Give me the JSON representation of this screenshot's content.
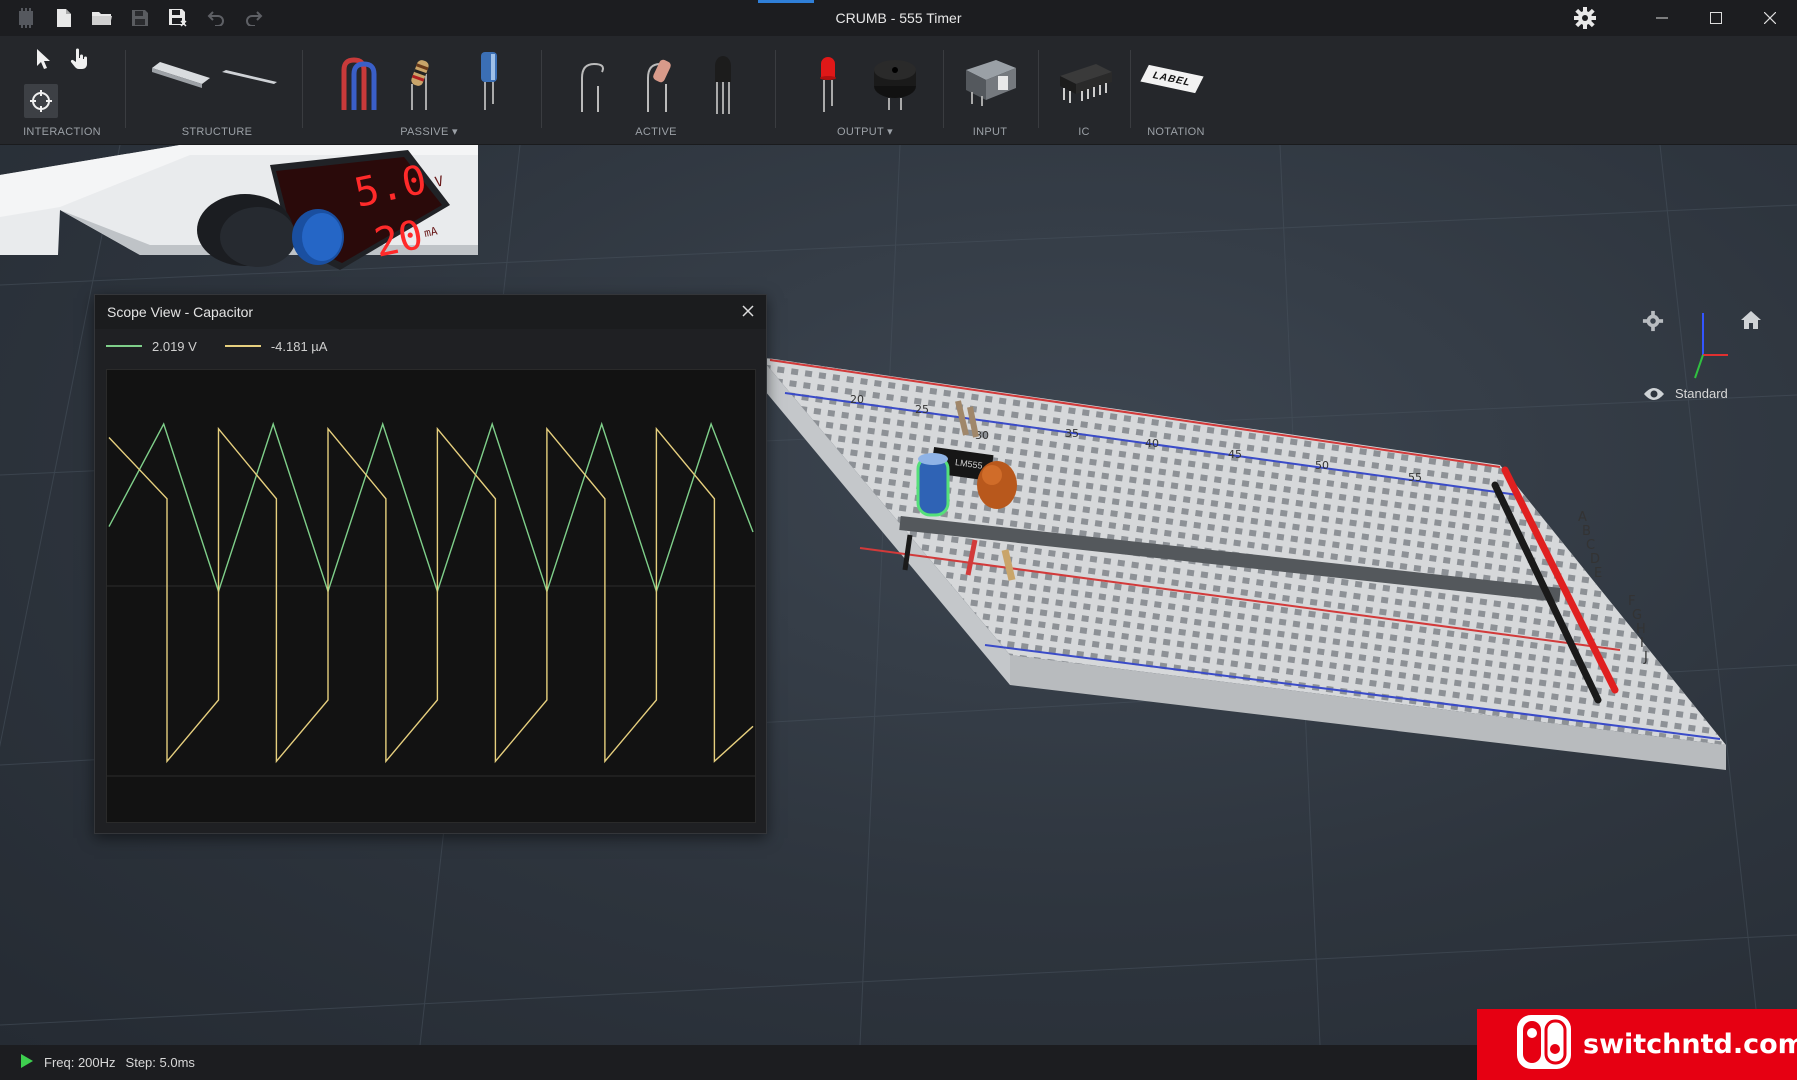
{
  "window": {
    "title": "CRUMB - 555 Timer"
  },
  "toolbar": {
    "groups": [
      {
        "label": "INTERACTION"
      },
      {
        "label": "STRUCTURE"
      },
      {
        "label": "PASSIVE",
        "has_dropdown": true
      },
      {
        "label": "ACTIVE"
      },
      {
        "label": "OUTPUT",
        "has_dropdown": true
      },
      {
        "label": "INPUT"
      },
      {
        "label": "IC"
      },
      {
        "label": "NOTATION"
      }
    ],
    "notation_label_text": "LABEL"
  },
  "power_supply": {
    "voltage": "5.0",
    "voltage_unit": "V",
    "current": "20",
    "current_unit": "mA"
  },
  "scope": {
    "title": "Scope View - Capacitor",
    "legend": [
      {
        "value": "2.019 V",
        "color": "#7fcf8a"
      },
      {
        "value": "-4.181 µA",
        "color": "#e6cf7e"
      }
    ]
  },
  "chart_data": {
    "type": "line",
    "title": "",
    "xlabel": "",
    "ylabel": "",
    "grid": true,
    "series": [
      {
        "name": "2.019 V",
        "color": "#7fcf8a",
        "x": [
          0,
          0.085,
          0.17,
          0.255,
          0.34,
          0.425,
          0.51,
          0.595,
          0.68,
          0.765,
          0.85,
          0.935,
          1.0
        ],
        "y": [
          0.38,
          0.95,
          0.02,
          0.95,
          0.02,
          0.95,
          0.02,
          0.95,
          0.02,
          0.95,
          0.02,
          0.95,
          0.35
        ]
      },
      {
        "name": "-4.181 µA",
        "color": "#e6cf7e",
        "x": [
          0,
          0.09,
          0.09,
          0.17,
          0.17,
          0.26,
          0.26,
          0.34,
          0.34,
          0.43,
          0.43,
          0.51,
          0.51,
          0.6,
          0.6,
          0.68,
          0.68,
          0.77,
          0.77,
          0.85,
          0.85,
          0.94,
          0.94,
          1.0
        ],
        "y": [
          0.9,
          0.55,
          -0.95,
          -0.6,
          0.95,
          0.55,
          -0.95,
          -0.6,
          0.95,
          0.55,
          -0.95,
          -0.6,
          0.95,
          0.55,
          -0.95,
          -0.6,
          0.95,
          0.55,
          -0.95,
          -0.6,
          0.95,
          0.55,
          -0.95,
          -0.75
        ]
      }
    ]
  },
  "viewport": {
    "view_mode": "Standard"
  },
  "breadboard": {
    "column_labels": [
      "20",
      "25",
      "30",
      "35",
      "40",
      "45",
      "50",
      "55"
    ],
    "row_labels_top": [
      "A",
      "B",
      "C",
      "D",
      "E"
    ],
    "row_labels_bottom": [
      "F",
      "G",
      "H",
      "I",
      "J"
    ],
    "ic_label": "LM555"
  },
  "status": {
    "freq": "Freq: 200Hz",
    "step": "Step: 5.0ms"
  },
  "watermark": {
    "text": "switchntd.com"
  }
}
